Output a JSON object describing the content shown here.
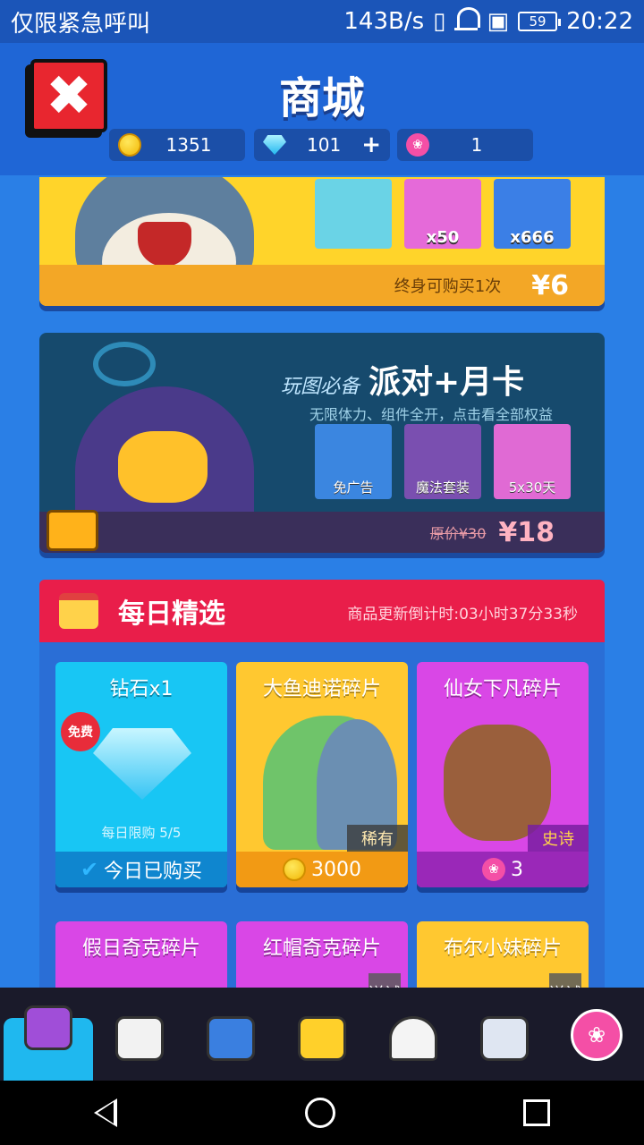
{
  "status_bar": {
    "left_text": "仅限紧急呼叫",
    "net_speed": "143B/s",
    "battery": "59",
    "time": "20:22"
  },
  "header": {
    "title": "商城",
    "currencies": {
      "coins": "1351",
      "gems": "101",
      "lotus": "1"
    }
  },
  "banner_starter": {
    "tiles": [
      "",
      "x50",
      "x666"
    ],
    "note": "终身可购买1次",
    "price": "¥6"
  },
  "banner_party": {
    "script_title": "玩图必备",
    "title": "派对+月卡",
    "subtitle": "无限体力、组件全开，点击看全部权益",
    "tiles": [
      "免广告",
      "魔法套装",
      "5x30天"
    ],
    "original_price": "原价¥30",
    "price": "¥18"
  },
  "daily": {
    "title": "每日精选",
    "countdown": "商品更新倒计时:03小时37分33秒",
    "cards": [
      {
        "name": "钻石x1",
        "badge": "免费",
        "limit": "每日限购 5/5",
        "footer": "今日已购买"
      },
      {
        "name": "大鱼迪诺碎片",
        "rarity": "稀有",
        "price": "3000"
      },
      {
        "name": "仙女下凡碎片",
        "rarity": "史诗",
        "price": "3"
      },
      {
        "name": "假日奇克碎片"
      },
      {
        "name": "红帽奇克碎片",
        "trial": "送试用"
      },
      {
        "name": "布尔小妹碎片",
        "trial": "送试用"
      }
    ]
  },
  "tabbar": {
    "icons": [
      "chest-icon",
      "star-chat-icon",
      "pig-tv-icon",
      "chick-face-icon",
      "dog-icon",
      "stamp-icon",
      "lotus-icon"
    ]
  }
}
